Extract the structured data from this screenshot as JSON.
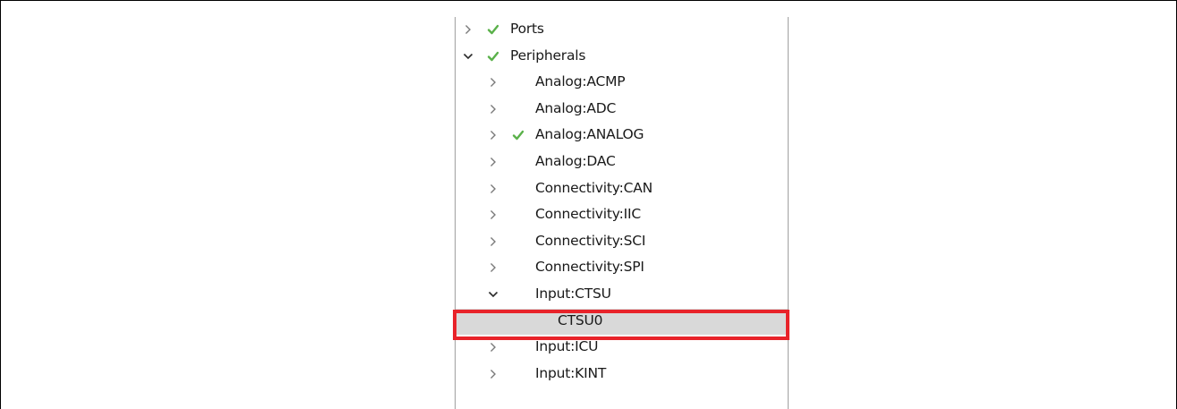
{
  "colors": {
    "check": "#5ab14a",
    "toggle": "#7a7a7a",
    "selected_bg": "#d9d9d9",
    "highlight": "#e8232a"
  },
  "tree": [
    {
      "label": "Ports",
      "toggle": "chevron-right",
      "checked": true,
      "level": 0,
      "selected": false
    },
    {
      "label": "Peripherals",
      "toggle": "chevron-down",
      "checked": true,
      "level": 0,
      "selected": false
    },
    {
      "label": "Analog:ACMP",
      "toggle": "chevron-right",
      "checked": false,
      "level": 1,
      "selected": false
    },
    {
      "label": "Analog:ADC",
      "toggle": "chevron-right",
      "checked": false,
      "level": 1,
      "selected": false
    },
    {
      "label": "Analog:ANALOG",
      "toggle": "chevron-right",
      "checked": true,
      "level": 1,
      "selected": false
    },
    {
      "label": "Analog:DAC",
      "toggle": "chevron-right",
      "checked": false,
      "level": 1,
      "selected": false
    },
    {
      "label": "Connectivity:CAN",
      "toggle": "chevron-right",
      "checked": false,
      "level": 1,
      "selected": false
    },
    {
      "label": "Connectivity:IIC",
      "toggle": "chevron-right",
      "checked": false,
      "level": 1,
      "selected": false
    },
    {
      "label": "Connectivity:SCI",
      "toggle": "chevron-right",
      "checked": false,
      "level": 1,
      "selected": false
    },
    {
      "label": "Connectivity:SPI",
      "toggle": "chevron-right",
      "checked": false,
      "level": 1,
      "selected": false
    },
    {
      "label": "Input:CTSU",
      "toggle": "chevron-down",
      "checked": false,
      "level": 1,
      "selected": false
    },
    {
      "label": "CTSU0",
      "toggle": "none",
      "checked": false,
      "level": 2,
      "selected": true
    },
    {
      "label": "Input:ICU",
      "toggle": "chevron-right",
      "checked": false,
      "level": 1,
      "selected": false
    },
    {
      "label": "Input:KINT",
      "toggle": "chevron-right",
      "checked": false,
      "level": 1,
      "selected": false
    }
  ]
}
